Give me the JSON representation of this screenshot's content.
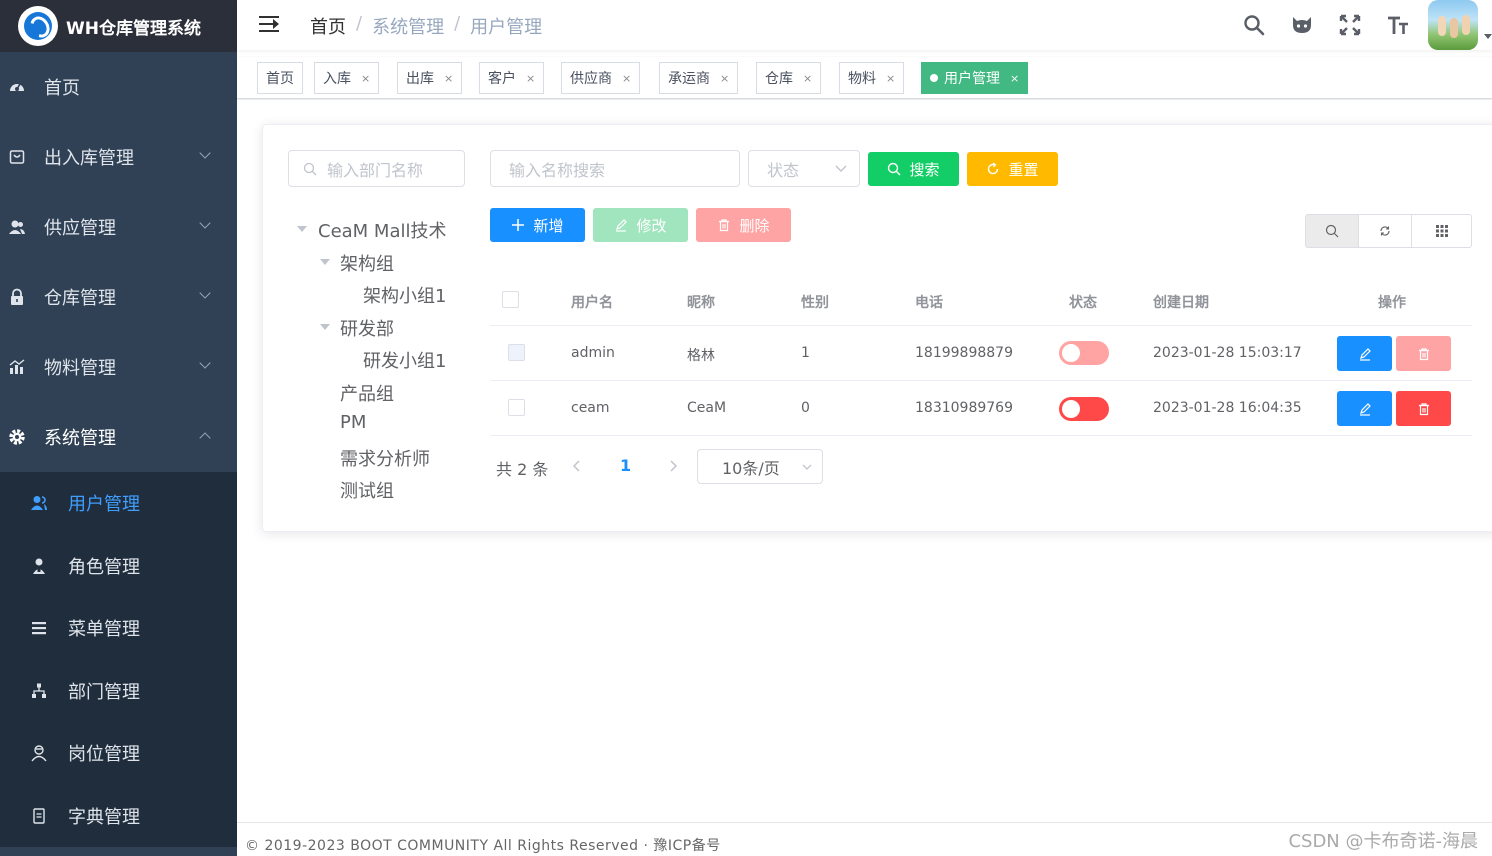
{
  "app": {
    "title": "WH仓库管理系统"
  },
  "sidebar": {
    "items": [
      {
        "label": "首页",
        "icon": "dashboard-icon"
      },
      {
        "label": "出入库管理",
        "icon": "shopping-icon"
      },
      {
        "label": "供应管理",
        "icon": "peoples-icon"
      },
      {
        "label": "仓库管理",
        "icon": "lock-icon"
      },
      {
        "label": "物料管理",
        "icon": "chart-icon"
      },
      {
        "label": "系统管理",
        "icon": "system-icon"
      }
    ],
    "subitems": [
      {
        "label": "用户管理",
        "icon": "user-icon"
      },
      {
        "label": "角色管理",
        "icon": "peoples-icon"
      },
      {
        "label": "菜单管理",
        "icon": "tree-table-icon"
      },
      {
        "label": "部门管理",
        "icon": "tree-icon"
      },
      {
        "label": "岗位管理",
        "icon": "post-icon"
      },
      {
        "label": "字典管理",
        "icon": "dict-icon"
      }
    ]
  },
  "header": {
    "breadcrumb": [
      "首页",
      "系统管理",
      "用户管理"
    ]
  },
  "tags": [
    "首页",
    "入库",
    "出库",
    "客户",
    "供应商",
    "承运商",
    "仓库",
    "物料",
    "用户管理"
  ],
  "filters": {
    "dept_placeholder": "输入部门名称",
    "name_placeholder": "输入名称搜索",
    "status_placeholder": "状态",
    "search_label": "搜索",
    "reset_label": "重置"
  },
  "tree": [
    "CeaM Mall技术",
    "架构组",
    "架构小组1",
    "研发部",
    "研发小组1",
    "产品组",
    "PM",
    "需求分析师",
    "测试组"
  ],
  "toolbar": {
    "add_label": "新增",
    "edit_label": "修改",
    "delete_label": "删除"
  },
  "table": {
    "headers": [
      "用户名",
      "昵称",
      "性别",
      "电话",
      "状态",
      "创建日期",
      "操作"
    ],
    "rows": [
      {
        "username": "admin",
        "nickname": "格林",
        "gender": "1",
        "phone": "18199898879",
        "date": "2023-01-28 15:03:17"
      },
      {
        "username": "ceam",
        "nickname": "CeaM",
        "gender": "0",
        "phone": "18310989769",
        "date": "2023-01-28 16:04:35"
      }
    ]
  },
  "pagination": {
    "total": "共 2 条",
    "page": "1",
    "page_size": "10条/页"
  },
  "footer": {
    "copyright": "© 2019-2023 BOOT COMMUNITY All Rights Reserved · 豫ICP备号",
    "watermark": "CSDN @卡布奇诺-海晨"
  },
  "colors": {
    "sidebar_bg": "#304156",
    "primary": "#1890ff",
    "success": "#13ce66",
    "warning": "#ffba00",
    "danger": "#ff4949",
    "tag_active": "#42b983"
  }
}
